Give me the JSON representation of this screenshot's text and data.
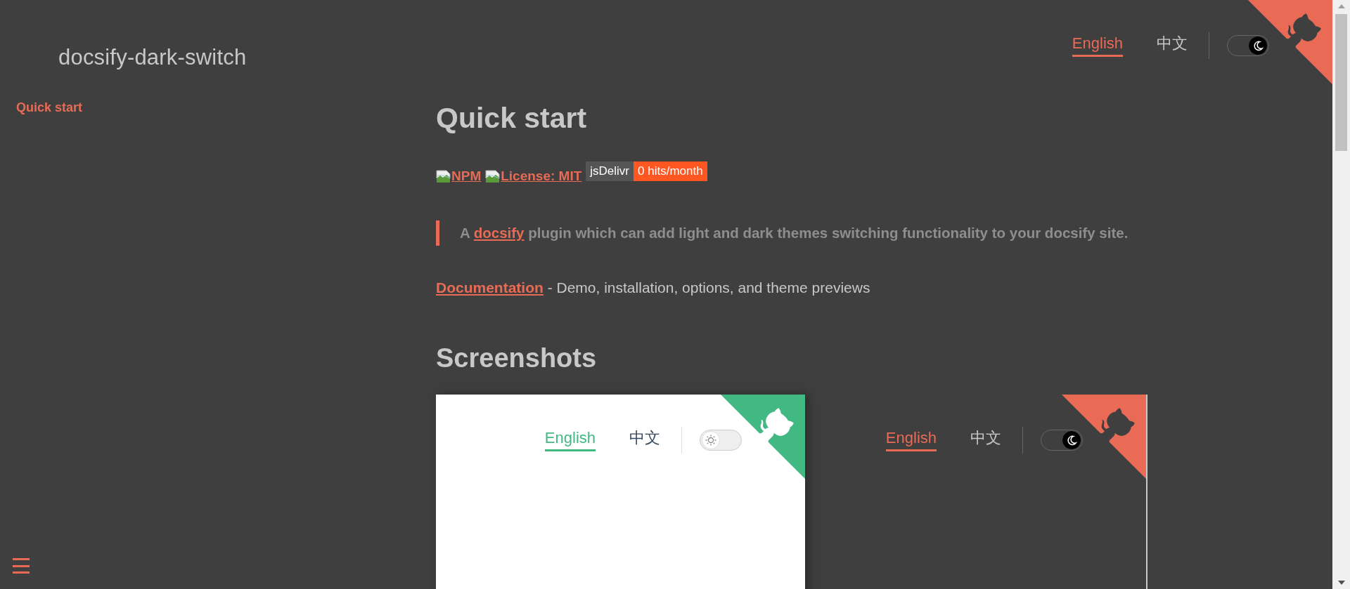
{
  "sidebar": {
    "title": "docsify-dark-switch",
    "items": [
      {
        "label": "Quick start",
        "selected": true
      }
    ]
  },
  "nav": {
    "links": [
      {
        "label": "English",
        "selected": true
      },
      {
        "label": "中文",
        "selected": false
      }
    ],
    "dark_mode": true
  },
  "content": {
    "heading": "Quick start",
    "badges": [
      {
        "kind": "image",
        "alt": "NPM"
      },
      {
        "kind": "image",
        "alt": "License: MIT"
      },
      {
        "kind": "counter",
        "label": "jsDelivr",
        "value": "0 hits/month"
      }
    ],
    "quote": {
      "before": "A ",
      "link": "docsify",
      "after": " plugin which can add light and dark themes switching functionality to your docsify site."
    },
    "docs_line": {
      "link": "Documentation",
      "after": " - Demo, installation, options, and theme previews"
    },
    "section_heading": "Screenshots",
    "screenshots": [
      {
        "kind": "light",
        "nav": {
          "links": [
            {
              "label": "English",
              "selected": true
            },
            {
              "label": "中文",
              "selected": false
            }
          ],
          "dark_mode": false
        }
      },
      {
        "kind": "dark",
        "nav": {
          "links": [
            {
              "label": "English",
              "selected": true
            },
            {
              "label": "中文",
              "selected": false
            }
          ],
          "dark_mode": true
        }
      }
    ]
  }
}
